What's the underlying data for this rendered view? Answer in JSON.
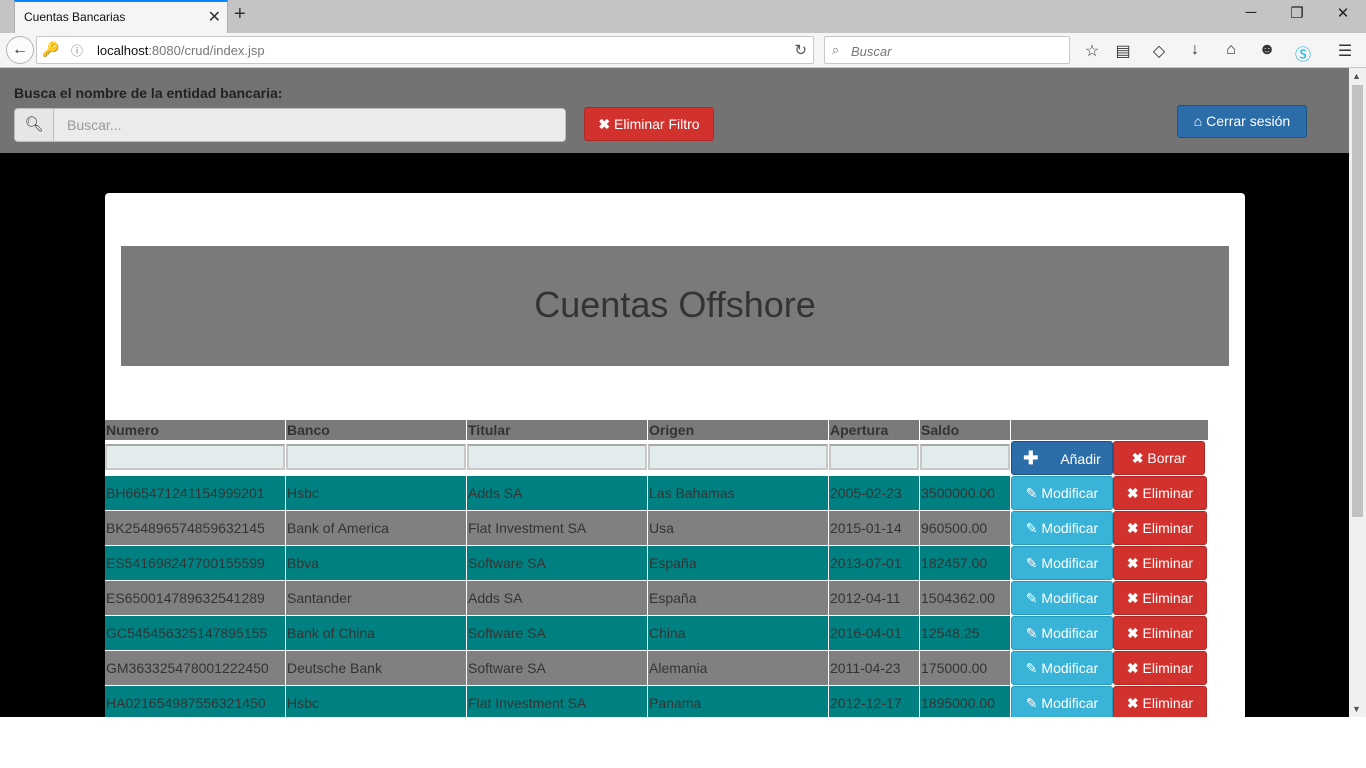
{
  "browser": {
    "tab_title": "Cuentas Bancarias",
    "url_host": "localhost",
    "url_rest": ":8080/crud/index.jsp",
    "search_placeholder": "Buscar"
  },
  "filter": {
    "label": "Busca el nombre de la entidad bancaria:",
    "placeholder": "Buscar...",
    "clear_label": "Eliminar Filtro",
    "logout_label": "Cerrar sesión"
  },
  "title": "Cuentas Offshore",
  "table": {
    "headers": [
      "Numero",
      "Banco",
      "Titular",
      "Origen",
      "Apertura",
      "Saldo"
    ],
    "add_label": "Añadir",
    "clear_label": "Borrar",
    "modify_label": "Modificar",
    "delete_label": "Eliminar",
    "rows": [
      [
        "BH665471241154999201",
        "Hsbc",
        "Adds SA",
        "Las Bahamas",
        "2005-02-23",
        "3500000.00"
      ],
      [
        "BK254896574859632145",
        "Bank of America",
        "Flat Investment SA",
        "Usa",
        "2015-01-14",
        "960500.00"
      ],
      [
        "ES541698247700155599",
        "Bbva",
        "Software SA",
        "España",
        "2013-07-01",
        "182457.00"
      ],
      [
        "ES650014789632541289",
        "Santander",
        "Adds SA",
        "España",
        "2012-04-11",
        "1504362.00"
      ],
      [
        "GC545456325147895155",
        "Bank of China",
        "Software SA",
        "China",
        "2016-04-01",
        "12548.25"
      ],
      [
        "GM363325478001222450",
        "Deutsche Bank",
        "Software SA",
        "Alemania",
        "2011-04-23",
        "175000.00"
      ],
      [
        "HA021654987556321450",
        "Hsbc",
        "Flat Investment SA",
        "Panama",
        "2012-12-17",
        "1895000.00"
      ]
    ]
  },
  "colors": {
    "row_teal": "#008080",
    "row_grey": "#808080",
    "danger": "#d2322d",
    "info": "#39b3d7",
    "primary": "#2a6da8"
  },
  "icons": {
    "search": "search-icon",
    "remove": "times-icon",
    "home": "home-icon",
    "plus": "plus-icon",
    "pencil": "pencil-icon"
  }
}
